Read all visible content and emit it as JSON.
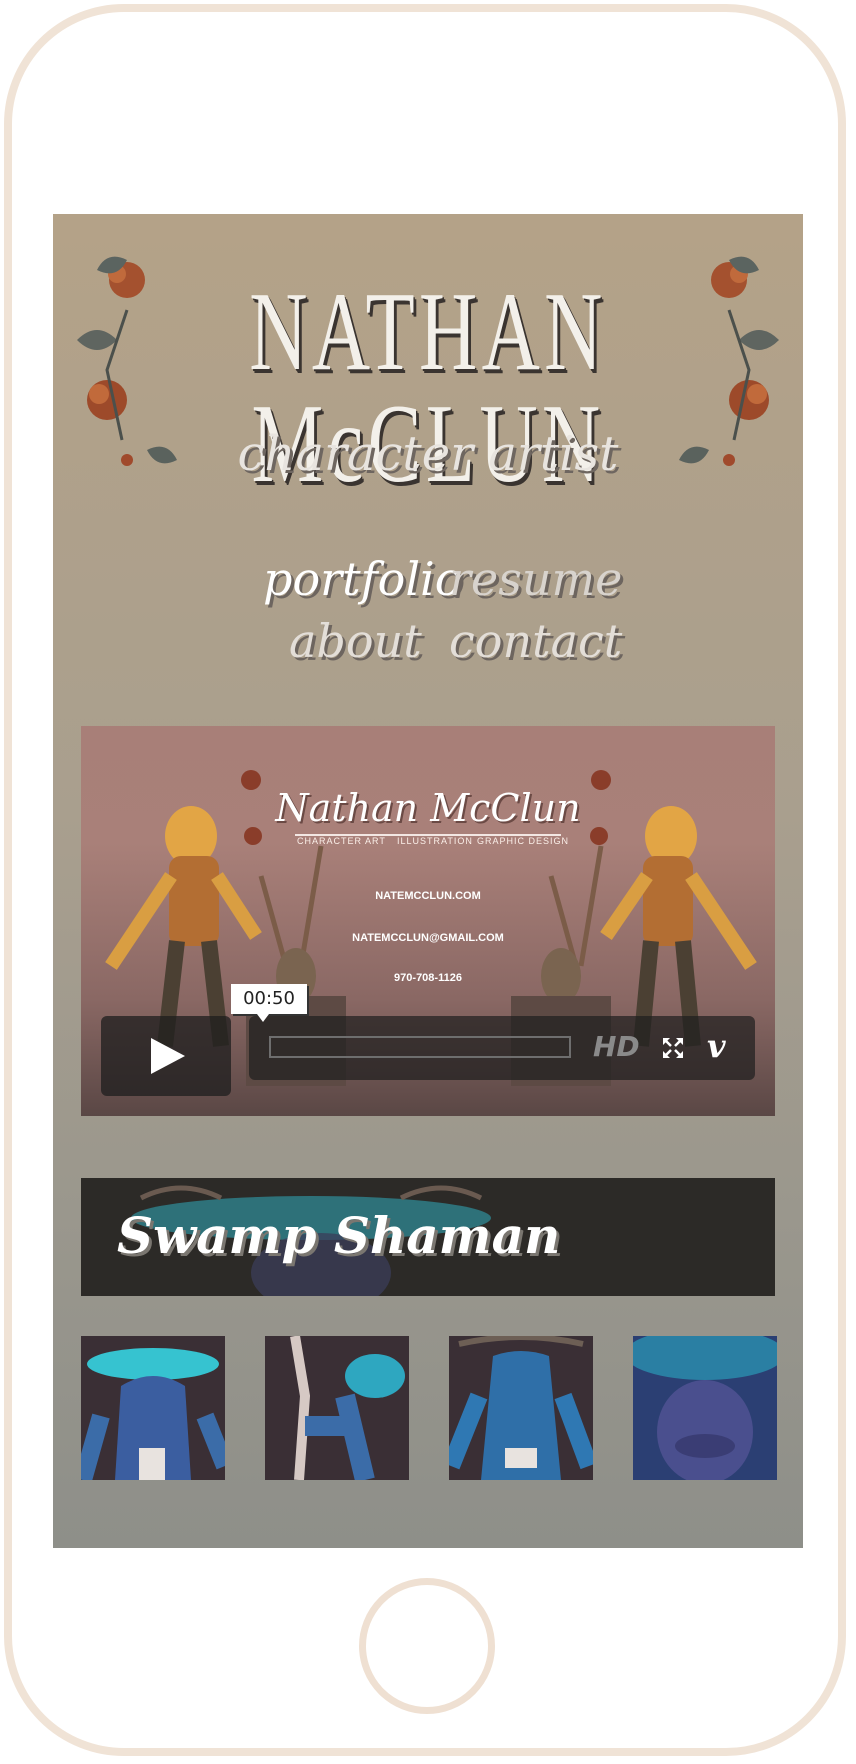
{
  "header": {
    "site_title": "NATHAN McCLUN",
    "subtitle": "character artist"
  },
  "nav": {
    "items": [
      "portfolio",
      "resume",
      "about",
      "contact"
    ]
  },
  "video": {
    "card_title": "Nathan McClun",
    "card_subtitles": [
      "CHARACTER ART",
      "ILLUSTRATION",
      "GRAPHIC DESIGN"
    ],
    "website": "NATEMCCLUN.COM",
    "email": "NATEMCCLUN@GMAIL.COM",
    "phone": "970-708-1126",
    "duration": "00:50",
    "hd_label": "HD",
    "vimeo_label": "v",
    "icons": {
      "play": "play-icon",
      "fullscreen": "fullscreen-icon",
      "vimeo": "vimeo-icon"
    }
  },
  "project": {
    "title": "Swamp Shaman",
    "thumbnails": [
      "swamp-shaman-front",
      "swamp-shaman-staff",
      "swamp-shaman-back",
      "swamp-shaman-face"
    ]
  },
  "colors": {
    "phone_frame": "#f0e3d6",
    "screen_top": "#b4a288",
    "screen_bottom": "#8e8f89",
    "video_bg": "#a87f78",
    "banner_bg": "#2c2a27"
  }
}
